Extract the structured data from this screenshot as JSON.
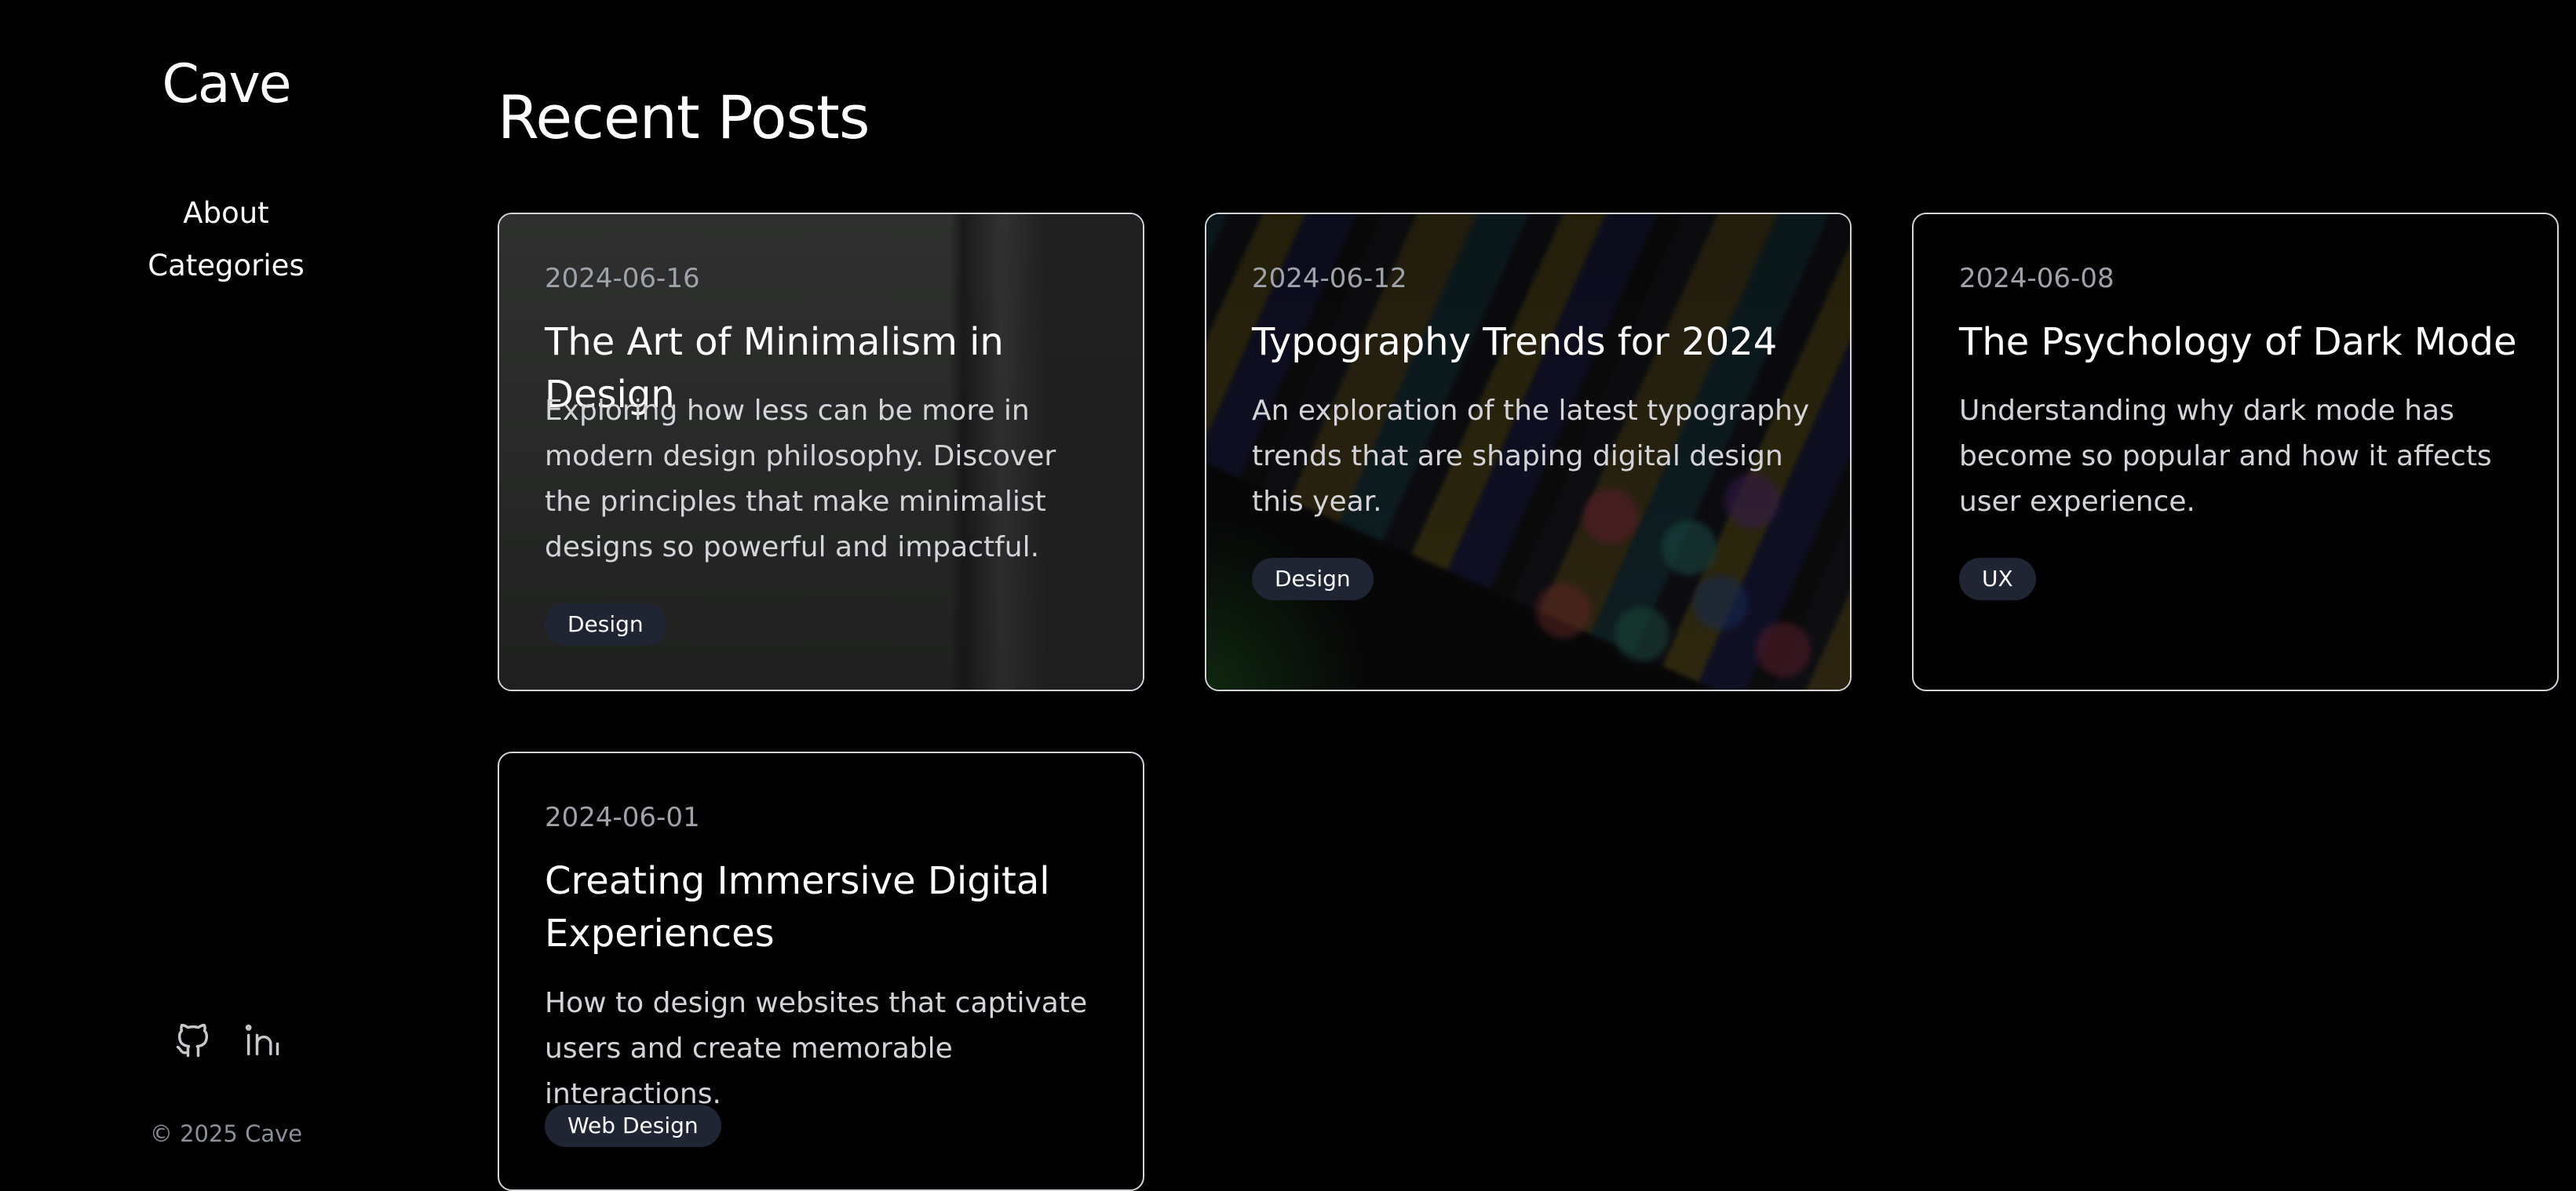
{
  "sidebar": {
    "logo": "Cave",
    "nav": [
      {
        "label": "About"
      },
      {
        "label": "Categories"
      }
    ],
    "social": [
      {
        "icon": "github-icon"
      },
      {
        "icon": "linkedin-icon"
      }
    ],
    "copyright": "© 2025 Cave"
  },
  "main": {
    "title": "Recent Posts",
    "posts": [
      {
        "date": "2024-06-16",
        "title": "The Art of Minimalism in Design",
        "description": "Exploring how less can be more in modern design philosophy. Discover the principles that make minimalist designs so powerful and impactful.",
        "tag": "Design"
      },
      {
        "date": "2024-06-12",
        "title": "Typography Trends for 2024",
        "description": "An exploration of the latest typography trends that are shaping digital design this year.",
        "tag": "Design"
      },
      {
        "date": "2024-06-08",
        "title": "The Psychology of Dark Mode",
        "description": "Understanding why dark mode has become so popular and how it affects user experience.",
        "tag": "UX"
      },
      {
        "date": "2024-06-01",
        "title": "Creating Immersive Digital Experiences",
        "description": "How to design websites that captivate users and create memorable interactions.",
        "tag": "Web Design"
      }
    ]
  },
  "colors": {
    "background": "#000000",
    "card_border": "#d4d4d8",
    "tag_background": "#1f2533",
    "muted_text": "#a1a1aa"
  }
}
